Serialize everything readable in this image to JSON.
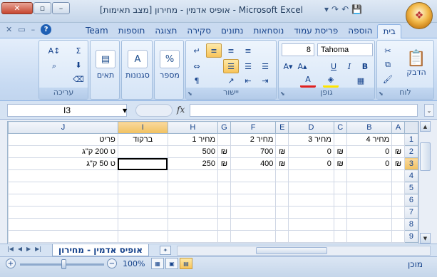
{
  "window": {
    "title": "אופיס אדמין - מחירון  [מצב תאימות] - Microsoft Excel",
    "minimize": "–",
    "restore": "▫",
    "close": "✕"
  },
  "qat": {
    "save": "💾",
    "undo": "↶",
    "redo": "↷",
    "more": "▾"
  },
  "tabs": [
    "בית",
    "הוספה",
    "פריסת עמוד",
    "נוסחאות",
    "נתונים",
    "סקירה",
    "תצוגה",
    "תוספות",
    "Team"
  ],
  "ribbon": {
    "clipboard": {
      "label": "לוח",
      "paste": "הדבק"
    },
    "font": {
      "label": "גופן",
      "name": "Tahoma",
      "size": "8"
    },
    "alignment": {
      "label": "יישור"
    },
    "number": {
      "label": "מספר"
    },
    "styles": {
      "label": "סגנונות"
    },
    "cells": {
      "label": "תאים"
    },
    "editing": {
      "label": "עריכה"
    }
  },
  "formula_bar": {
    "name_box": "I3",
    "fx": "fx",
    "formula": ""
  },
  "sheet": {
    "columns": [
      "J",
      "I",
      "H",
      "G",
      "F",
      "E",
      "D",
      "C",
      "B",
      "A"
    ],
    "rows": [
      {
        "num": "1",
        "cells": [
          "פריט",
          "ברקוד",
          "מחיר 1",
          "",
          "מחיר 2",
          "",
          "מחיר 3",
          "",
          "מחיר 4",
          ""
        ]
      },
      {
        "num": "2",
        "cells": [
          "ט 200 ק\"ג",
          "",
          "500",
          "₪",
          "700",
          "₪",
          "0",
          "₪",
          "0",
          "₪"
        ]
      },
      {
        "num": "3",
        "cells": [
          "ט 50 ק\"ג",
          "",
          "250",
          "₪",
          "400",
          "₪",
          "0",
          "₪",
          "0",
          "₪"
        ]
      },
      {
        "num": "4",
        "cells": [
          "",
          "",
          "",
          "",
          "",
          "",
          "",
          "",
          "",
          ""
        ]
      },
      {
        "num": "5",
        "cells": [
          "",
          "",
          "",
          "",
          "",
          "",
          "",
          "",
          "",
          ""
        ]
      },
      {
        "num": "6",
        "cells": [
          "",
          "",
          "",
          "",
          "",
          "",
          "",
          "",
          "",
          ""
        ]
      },
      {
        "num": "7",
        "cells": [
          "",
          "",
          "",
          "",
          "",
          "",
          "",
          "",
          "",
          ""
        ]
      },
      {
        "num": "8",
        "cells": [
          "",
          "",
          "",
          "",
          "",
          "",
          "",
          "",
          "",
          ""
        ]
      },
      {
        "num": "9",
        "cells": [
          "",
          "",
          "",
          "",
          "",
          "",
          "",
          "",
          "",
          ""
        ]
      }
    ]
  },
  "sheet_tabs": {
    "active": "אופיס אדמין - מחירון"
  },
  "status": {
    "ready": "מוכן",
    "zoom": "100%"
  },
  "colors": {
    "accent": "#15428b",
    "selected_header": "#f1c15f",
    "ribbon_bg": "#c7daf2"
  }
}
